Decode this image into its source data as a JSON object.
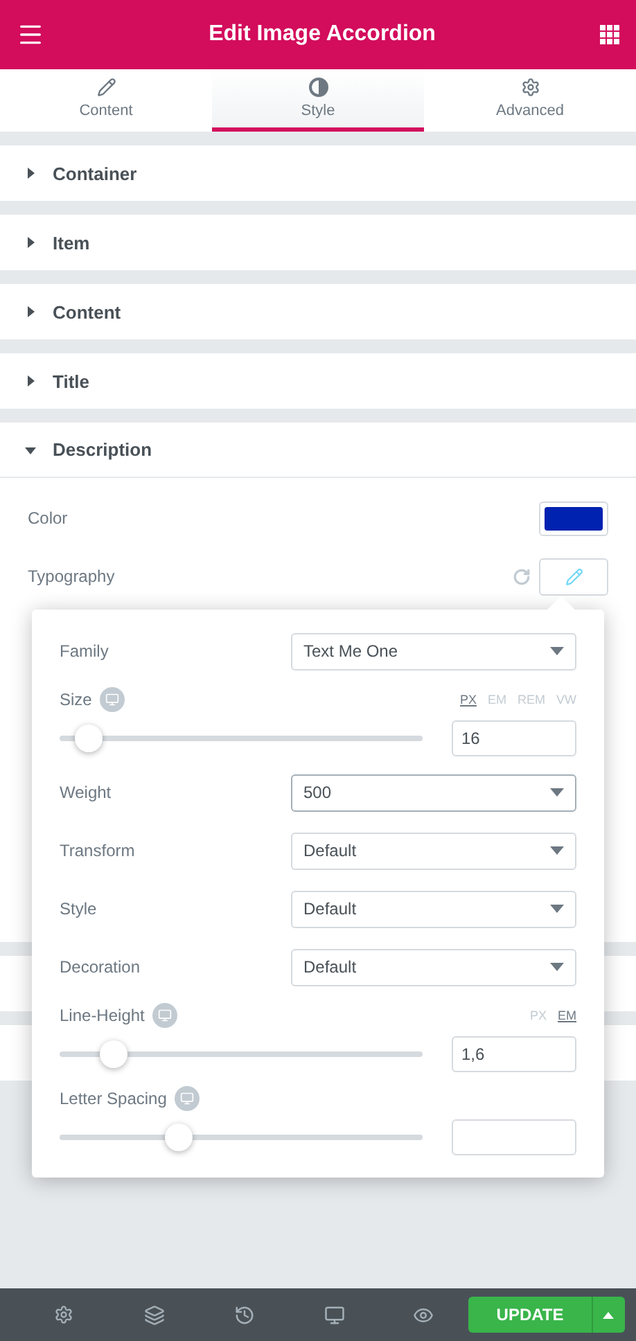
{
  "header": {
    "title": "Edit Image Accordion"
  },
  "tabs": [
    {
      "label": "Content",
      "selected": false
    },
    {
      "label": "Style",
      "selected": true
    },
    {
      "label": "Advanced",
      "selected": false
    }
  ],
  "sections": [
    {
      "title": "Container",
      "expanded": false
    },
    {
      "title": "Item",
      "expanded": false
    },
    {
      "title": "Content",
      "expanded": false
    },
    {
      "title": "Title",
      "expanded": false
    },
    {
      "title": "Description",
      "expanded": true
    }
  ],
  "description": {
    "color": {
      "label": "Color",
      "color": "#0022b0"
    },
    "typography": {
      "label": "Typography"
    }
  },
  "typography_popover": {
    "fields": [
      {
        "kind": "select",
        "label": "Family",
        "value": "Text Me One",
        "focused": false
      },
      {
        "kind": "slider",
        "label": "Size",
        "units": [
          {
            "label": "PX",
            "selected": true
          },
          {
            "label": "EM",
            "selected": false
          },
          {
            "label": "REM",
            "selected": false
          },
          {
            "label": "VW",
            "selected": false
          }
        ],
        "level": 0.08,
        "value": "16"
      },
      {
        "kind": "select",
        "label": "Weight",
        "value": "500",
        "focused": true
      },
      {
        "kind": "select",
        "label": "Transform",
        "value": "Default",
        "focused": false
      },
      {
        "kind": "select",
        "label": "Style",
        "value": "Default",
        "focused": false
      },
      {
        "kind": "select",
        "label": "Decoration",
        "value": "Default",
        "focused": false
      },
      {
        "kind": "slider",
        "label": "Line-Height",
        "units": [
          {
            "label": "PX",
            "selected": false
          },
          {
            "label": "EM",
            "selected": true
          }
        ],
        "level": 0.15,
        "value": "1,6"
      },
      {
        "kind": "slider",
        "label": "Letter Spacing",
        "level": 0.33
      }
    ]
  },
  "footer": {
    "update_label": "UPDATE"
  }
}
